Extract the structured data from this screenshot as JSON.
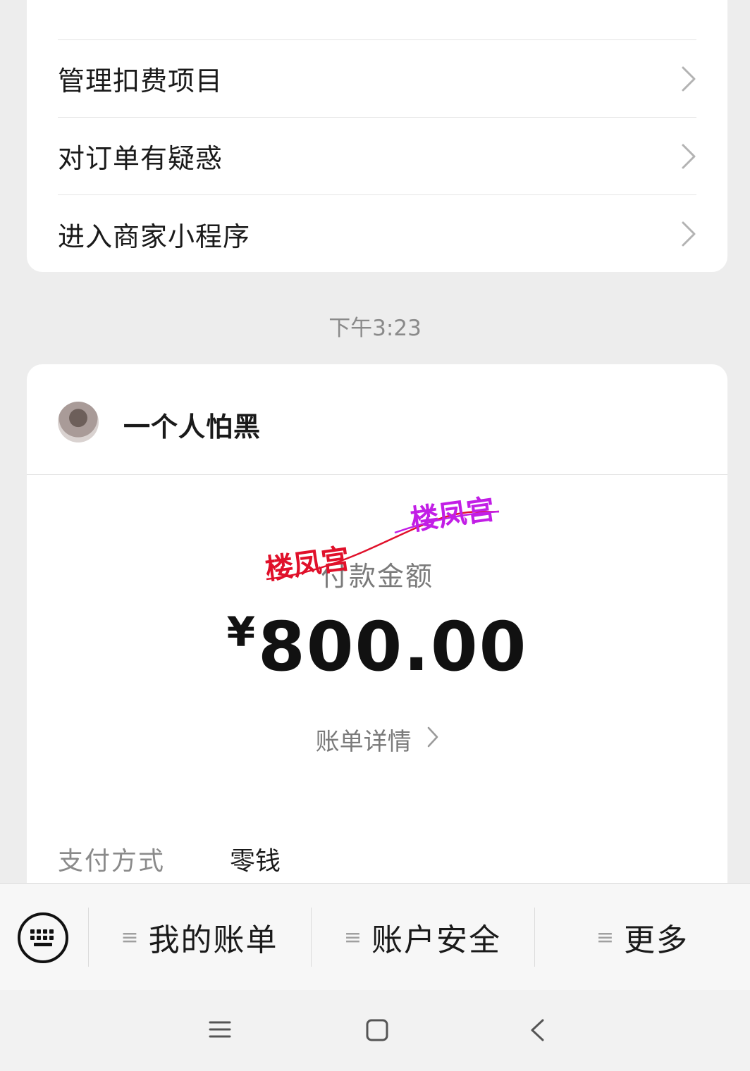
{
  "menu": {
    "items": [
      {
        "label": "管理扣费项目"
      },
      {
        "label": "对订单有疑惑"
      },
      {
        "label": "进入商家小程序"
      }
    ]
  },
  "timestamp": "下午3:23",
  "payment": {
    "merchant": "一个人怕黑",
    "amount_label": "付款金额",
    "currency": "¥",
    "amount": "800.00",
    "bill_detail": "账单详情",
    "method_label": "支付方式",
    "method_value": "零钱"
  },
  "watermark": {
    "text_left": "楼凤宫",
    "text_right": "楼凤宫",
    "color_left": "#e0102a",
    "color_right": "#c21ee6"
  },
  "bottom_bar": {
    "tabs": [
      {
        "lines_icon": "≡",
        "label": "我的账单"
      },
      {
        "lines_icon": "≡",
        "label": "账户安全"
      },
      {
        "lines_icon": "≡",
        "label": "更多"
      }
    ],
    "keyboard_icon": "keyboard-icon"
  },
  "system_nav": {
    "icons": [
      "menu-icon",
      "home-icon",
      "back-icon"
    ]
  }
}
